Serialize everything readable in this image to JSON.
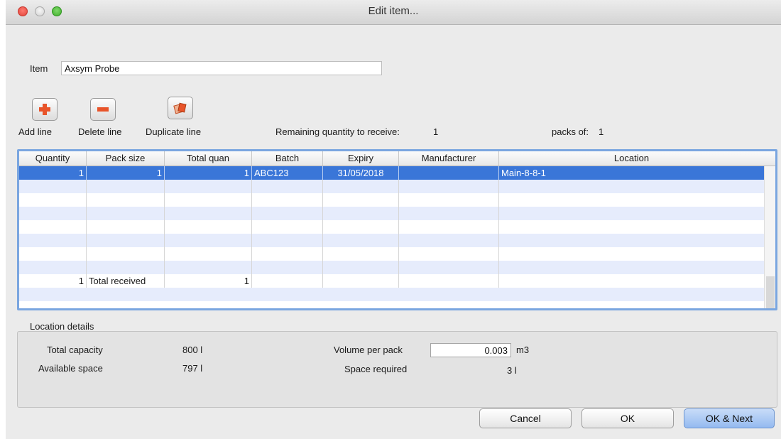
{
  "window": {
    "title": "Edit item..."
  },
  "item": {
    "label": "Item",
    "value": "Axsym Probe"
  },
  "toolbar": {
    "add_label": "Add line",
    "delete_label": "Delete line",
    "duplicate_label": "Duplicate line",
    "remaining_label": "Remaining quantity to receive:",
    "remaining_value": "1",
    "packs_label": "packs of:",
    "packs_value": "1"
  },
  "table": {
    "headers": [
      "Quantity",
      "Pack size",
      "Total quan",
      "Batch",
      "Expiry",
      "Manufacturer",
      "Location"
    ],
    "rows": [
      {
        "quantity": "1",
        "pack_size": "1",
        "total": "1",
        "batch": "ABC123",
        "expiry": "31/05/2018",
        "manufacturer": "",
        "location": "Main-8-8-1"
      }
    ],
    "totals": {
      "quantity": "1",
      "label": "Total received",
      "total": "1"
    }
  },
  "location_details": {
    "title": "Location details",
    "total_capacity_label": "Total capacity",
    "total_capacity_value": "800 l",
    "available_space_label": "Available space",
    "available_space_value": "797 l",
    "volume_per_pack_label": "Volume per pack",
    "volume_per_pack_value": "0.003",
    "volume_unit": "m3",
    "space_required_label": "Space required",
    "space_required_value": "3 l"
  },
  "buttons": {
    "cancel": "Cancel",
    "ok": "OK",
    "ok_next": "OK & Next"
  },
  "colors": {
    "selection": "#3a76d8",
    "alt_row": "#e6ecfc",
    "focus_ring": "#7aa6e0",
    "add_icon": "#e8542a"
  },
  "icons": {
    "add": "plus-icon",
    "delete": "minus-icon",
    "duplicate": "duplicate-cards-icon"
  }
}
